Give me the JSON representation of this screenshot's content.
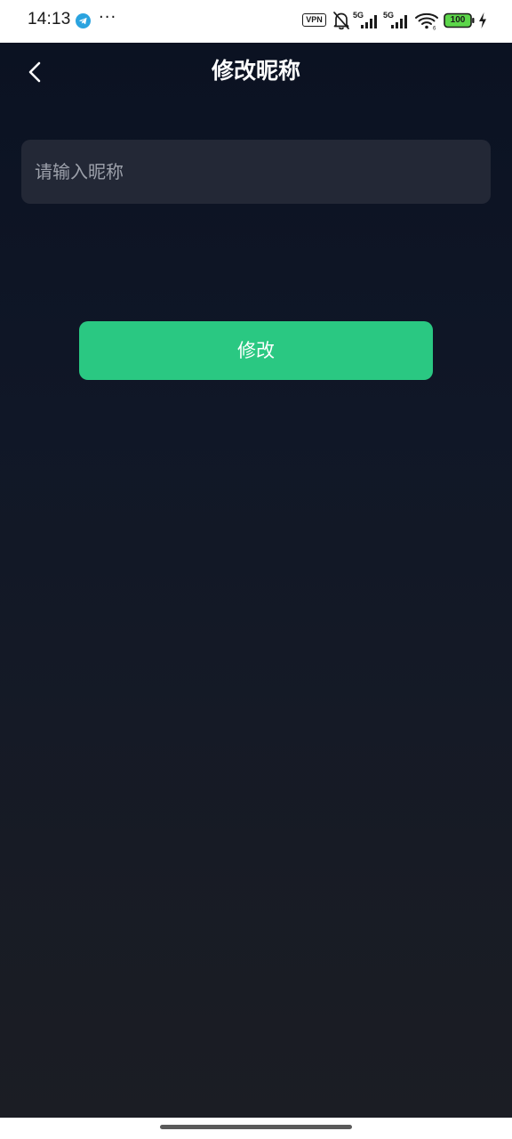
{
  "status_bar": {
    "time": "14:13",
    "more": "···",
    "vpn": "VPN",
    "sim1_type": "5G",
    "sim2_type": "5G",
    "battery": "100",
    "icons": [
      "telegram-icon",
      "more-icon",
      "vpn-icon",
      "bell-off-icon",
      "signal-icon",
      "signal-icon",
      "wifi-icon",
      "battery-icon",
      "charging-icon"
    ]
  },
  "header": {
    "back_icon": "chevron-left-icon",
    "title": "修改昵称"
  },
  "form": {
    "nickname_value": "",
    "nickname_placeholder": "请输入昵称",
    "submit_label": "修改"
  },
  "colors": {
    "background_top": "#0b1222",
    "background_bottom": "#1b1d24",
    "input_background": "#232836",
    "accent": "#2ac882",
    "placeholder": "#9ca0aa"
  }
}
